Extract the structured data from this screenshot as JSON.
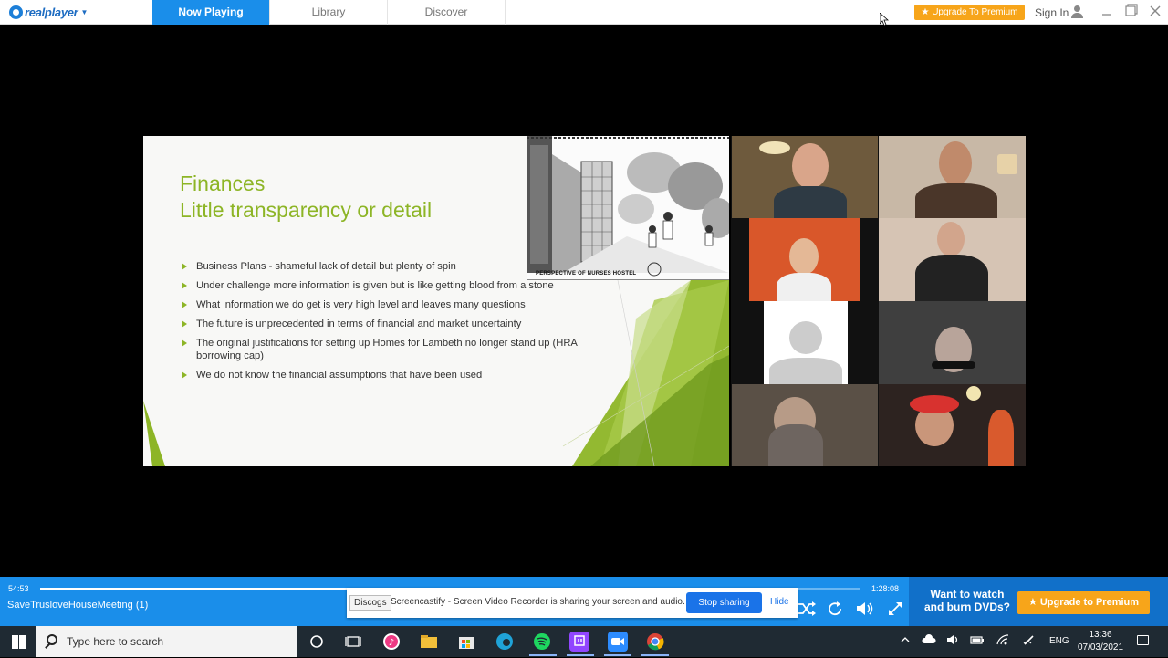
{
  "app": {
    "logo_text": "realplayer",
    "tabs": [
      {
        "label": "Now Playing",
        "active": true
      },
      {
        "label": "Library",
        "active": false
      },
      {
        "label": "Discover",
        "active": false
      }
    ],
    "upgrade_label": "★ Upgrade To Premium",
    "signin_label": "Sign In",
    "window_controls": [
      "minimize-icon",
      "restore-icon",
      "close-icon"
    ],
    "accent_color": "#1a8eea",
    "upgrade_color": "#f7a51a"
  },
  "slide": {
    "title_line1": "Finances",
    "title_line2": "Little transparency or detail",
    "sketch_caption": "PERSPECTIVE OF NURSES HOSTEL",
    "bullets": [
      "Business Plans - shameful lack of detail but plenty of spin",
      "Under challenge more information is given but is like getting blood from a stone",
      "What information we do get is very high level and leaves many questions",
      "The future is unprecedented in terms of financial and market uncertainty",
      "The original justifications for setting up Homes for Lambeth no longer stand up (HRA borrowing cap)",
      "We do not know the financial assumptions that have been used"
    ],
    "title_color": "#8db526"
  },
  "player": {
    "elapsed": "54:53",
    "duration": "1:28:08",
    "progress": 0.623,
    "media_title": "SaveTrusloveHouseMeeting (1)",
    "promo_text": "Want to watch and burn DVDs?",
    "upgrade_label": "★ Upgrade to Premium"
  },
  "share_banner": {
    "chip_label": "Discogs",
    "message": "Screencastify - Screen Video Recorder is sharing your screen and audio.",
    "stop_label": "Stop sharing",
    "hide_label": "Hide"
  },
  "taskbar": {
    "search_placeholder": "Type here to search",
    "tray_language": "ENG",
    "time": "13:36",
    "date": "07/03/2021"
  }
}
